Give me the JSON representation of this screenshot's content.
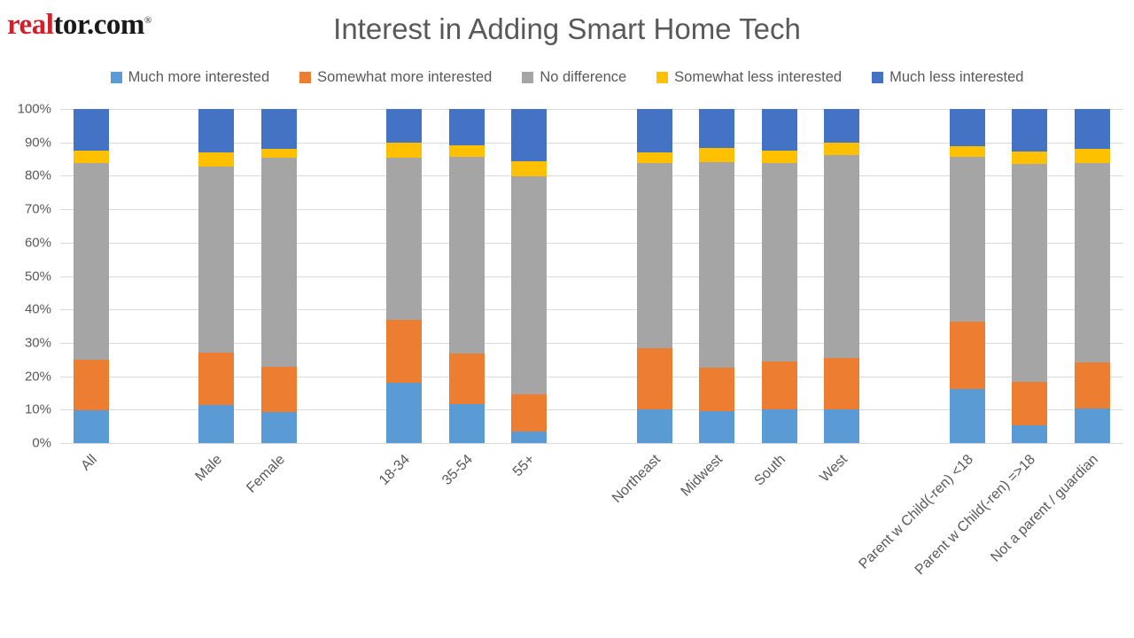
{
  "logo": {
    "part_red": "real",
    "part_dark": "tor.com",
    "trademark": "®"
  },
  "title": "Interest in Adding Smart Home Tech",
  "legend": {
    "items": [
      {
        "label": "Much more interested",
        "color": "#5B9BD5"
      },
      {
        "label": "Somewhat more interested",
        "color": "#ED7D31"
      },
      {
        "label": "No difference",
        "color": "#A5A5A5"
      },
      {
        "label": "Somewhat less interested",
        "color": "#FFC000"
      },
      {
        "label": "Much less interested",
        "color": "#4472C4"
      }
    ]
  },
  "axis": {
    "y_ticks": [
      "0%",
      "10%",
      "20%",
      "30%",
      "40%",
      "50%",
      "60%",
      "70%",
      "80%",
      "90%",
      "100%"
    ]
  },
  "chart_data": {
    "type": "bar",
    "stacked": true,
    "stacked_percent": true,
    "title": "Interest in Adding Smart Home Tech",
    "xlabel": "",
    "ylabel": "",
    "ylim": [
      0,
      100
    ],
    "ytick_labels": [
      "0%",
      "10%",
      "20%",
      "30%",
      "40%",
      "50%",
      "60%",
      "70%",
      "80%",
      "90%",
      "100%"
    ],
    "grid": true,
    "legend_position": "top",
    "categories": [
      "All",
      "",
      "Male",
      "Female",
      "",
      "18-34",
      "35-54",
      "55+",
      "",
      "Northeast",
      "Midwest",
      "South",
      "West",
      "",
      "Parent w Child(-ren) <18",
      "Parent w Child(-ren) =>18",
      "Not a parent / guardian"
    ],
    "series": [
      {
        "name": "Much more interested",
        "color": "#5B9BD5",
        "values": [
          9.8,
          null,
          11.4,
          9.3,
          null,
          18.0,
          11.7,
          3.4,
          null,
          10.1,
          9.5,
          10.1,
          10.1,
          null,
          16.2,
          5.3,
          10.3
        ]
      },
      {
        "name": "Somewhat more interested",
        "color": "#ED7D31",
        "values": [
          15.1,
          null,
          15.6,
          13.5,
          null,
          18.9,
          15.1,
          11.2,
          null,
          18.3,
          13.0,
          14.3,
          15.4,
          null,
          20.1,
          13.0,
          13.8
        ]
      },
      {
        "name": "No difference",
        "color": "#A5A5A5",
        "values": [
          58.9,
          null,
          55.7,
          62.6,
          null,
          48.5,
          58.8,
          65.2,
          null,
          55.4,
          61.5,
          59.4,
          60.7,
          null,
          49.3,
          65.3,
          59.7
        ]
      },
      {
        "name": "Somewhat less interested",
        "color": "#FFC000",
        "values": [
          3.8,
          null,
          4.2,
          2.6,
          null,
          4.6,
          3.5,
          4.5,
          null,
          3.1,
          4.3,
          3.8,
          3.8,
          null,
          3.3,
          3.6,
          4.2
        ]
      },
      {
        "name": "Much less interested",
        "color": "#4472C4",
        "values": [
          12.4,
          null,
          13.1,
          12.0,
          null,
          10.0,
          10.9,
          15.7,
          null,
          13.1,
          11.7,
          12.4,
          10.0,
          null,
          11.1,
          12.8,
          12.0
        ]
      }
    ]
  }
}
